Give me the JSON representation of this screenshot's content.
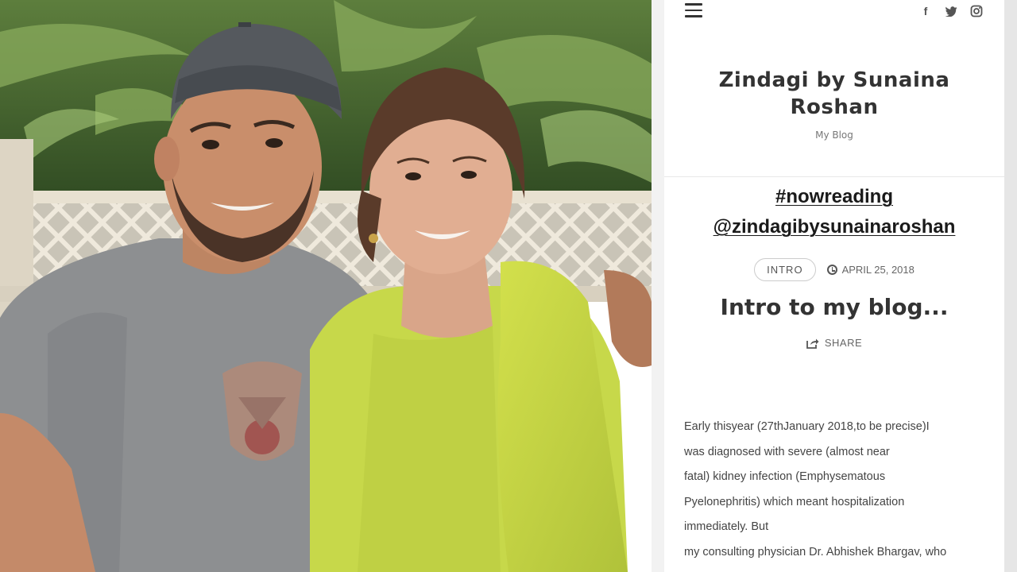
{
  "blog": {
    "title": "Zindagi by Sunaina Roshan",
    "tagline": "My Blog",
    "story_hashtag": "#nowreading",
    "story_handle": "@zindagibysunainaroshan",
    "category": "INTRO",
    "date": "APRIL 25, 2018",
    "post_title": "Intro to my blog...",
    "share_label": "SHARE",
    "body_lines": [
      "Early thisyear (27thJanuary 2018,to be precise)I",
      "was diagnosed with severe (almost near",
      "fatal) kidney infection (Emphysematous",
      "Pyelonephritis) which meant hospitalization",
      "immediately. But",
      "my consulting physician Dr. Abhishek Bhargav, who"
    ]
  },
  "icons": {
    "menu": "hamburger-menu-icon",
    "facebook": "facebook-icon",
    "twitter": "twitter-icon",
    "instagram": "instagram-icon",
    "clock": "clock-icon",
    "share": "share-icon"
  },
  "colors": {
    "lime_outfit": "#c7d84a",
    "grey_tshirt": "#8d8f91",
    "text_dark": "#333333"
  }
}
